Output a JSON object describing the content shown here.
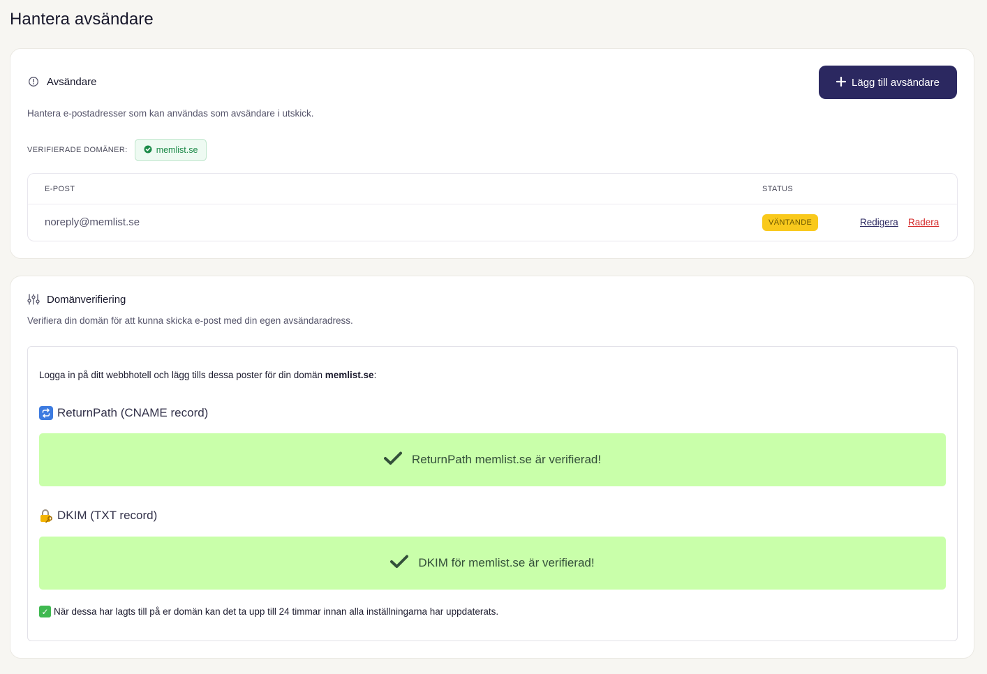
{
  "page": {
    "title": "Hantera avsändare"
  },
  "senders": {
    "heading": "Avsändare",
    "add_button_label": "Lägg till avsändare",
    "description": "Hantera e-postadresser som kan användas som avsändare i utskick.",
    "verified_domains_label": "VERIFIERADE DOMÄNER:",
    "verified_domains": [
      "memlist.se"
    ],
    "table": {
      "columns": {
        "email": "E-POST",
        "status": "STATUS"
      },
      "rows": [
        {
          "email": "noreply@memlist.se",
          "status": "VÄNTANDE",
          "edit_label": "Redigera",
          "delete_label": "Radera"
        }
      ]
    }
  },
  "domain_verification": {
    "heading": "Domänverifiering",
    "description": "Verifiera din domän för att kunna skicka e-post med din egen avsändaradress.",
    "instructions_prefix": "Logga in på ditt webbhotell och lägg tills dessa poster för din domän ",
    "instructions_domain": "memlist.se",
    "instructions_suffix": ":",
    "returnpath": {
      "title": "ReturnPath (CNAME record)",
      "status_text": "ReturnPath memlist.se är verifierad!"
    },
    "dkim": {
      "title": "DKIM (TXT record)",
      "status_text": "DKIM för memlist.se är verifierad!"
    },
    "footer_note": "När dessa har lagts till på er domän kan det ta upp till 24 timmar innan alla inställningarna har uppdaterats."
  },
  "colors": {
    "primary": "#2b2860",
    "success_bg": "#c9ffaa",
    "pending_badge": "#f9c91c",
    "danger": "#d42828"
  }
}
